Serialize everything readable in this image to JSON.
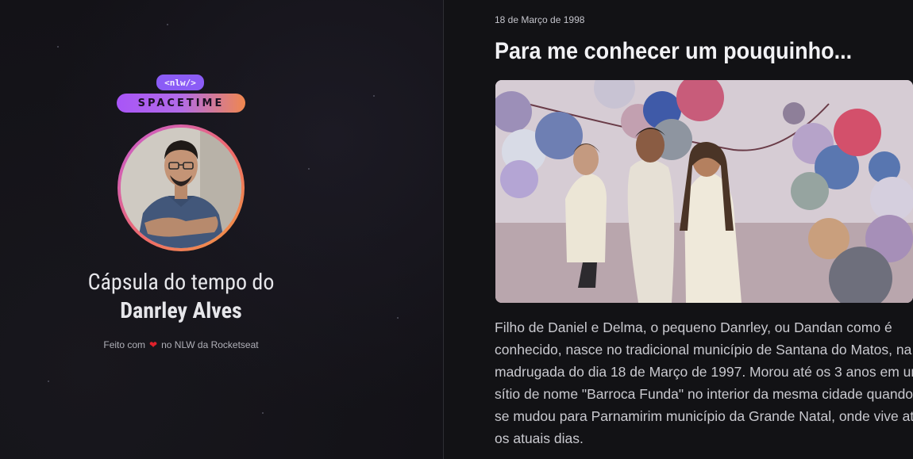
{
  "brand": {
    "tag": "<nlw/>",
    "name": "SPACETIME"
  },
  "profile": {
    "title_line1": "Cápsula do tempo do",
    "title_line2": "Danrley Alves",
    "credit_prefix": "Feito com",
    "credit_suffix": "no NLW da Rocketseat",
    "heart_icon": "heart-icon"
  },
  "memory": {
    "date": "18 de Março de 1998",
    "title": "Para me conhecer um pouquinho...",
    "body": "Filho de Daniel e Delma, o pequeno Danrley, ou Dandan como é conhecido, nasce no tradicional município de Santana do Matos, na madrugada do dia 18 de Março de 1997. Morou até os 3 anos em um sítio de nome \"Barroca Funda\" no interior da mesma cidade quando se mudou para Parnamirim município da Grande Natal, onde vive até os atuais dias."
  },
  "colors": {
    "background": "#121215",
    "brand_purple": "#8b5cf6",
    "brand_orange": "#f0874e",
    "heart": "#e0212b"
  }
}
